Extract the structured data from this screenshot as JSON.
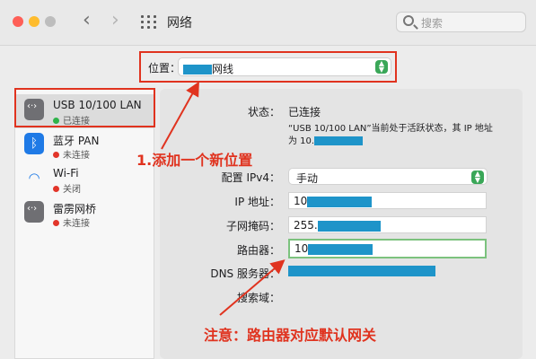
{
  "window": {
    "title": "网络",
    "search_placeholder": "搜索"
  },
  "location": {
    "label": "位置：",
    "value_suffix": "网线"
  },
  "sidebar": {
    "items": [
      {
        "name": "USB 10/100 LAN",
        "status": "已连接",
        "status_color": "#2fb34a"
      },
      {
        "name": "蓝牙 PAN",
        "status": "未连接",
        "status_color": "#e2352a"
      },
      {
        "name": "Wi-Fi",
        "status": "关闭",
        "status_color": "#e2352a"
      },
      {
        "name": "雷雳网桥",
        "status": "未连接",
        "status_color": "#e2352a"
      }
    ]
  },
  "details": {
    "status_label": "状态：",
    "status_value": "已连接",
    "status_desc_1": "“USB 10/100 LAN”当前处于活跃状态，其 IP 地址",
    "status_desc_2": "为 10.",
    "config_label": "配置 IPv4：",
    "config_value": "手动",
    "ip_label": "IP 地址：",
    "ip_value": "10",
    "mask_label": "子网掩码：",
    "mask_value": "255.",
    "router_label": "路由器：",
    "router_value": "10",
    "dns_label": "DNS 服务器：",
    "search_domain_label": "搜索域："
  },
  "annotations": {
    "note1": "1.添加一个新位置",
    "note2": "注意：路由器对应默认网关"
  },
  "colors": {
    "accent_red": "#e0331f",
    "redaction": "#1e94c9",
    "select_green": "#3aa758"
  }
}
